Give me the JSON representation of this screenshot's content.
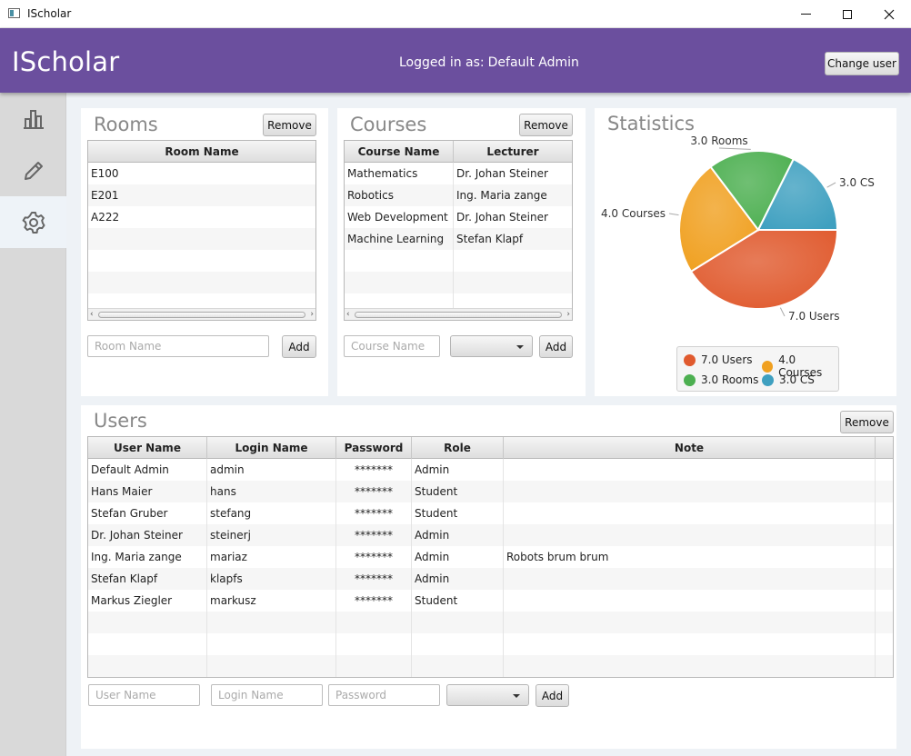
{
  "window": {
    "title": "IScholar"
  },
  "header": {
    "brand": "IScholar",
    "logged_label": "Logged in as:",
    "logged_user": "Default Admin",
    "change_user_label": "Change user"
  },
  "sidebar": {
    "items": [
      {
        "name": "statistics",
        "icon": "bar-chart-icon"
      },
      {
        "name": "edit",
        "icon": "pencil-icon"
      },
      {
        "name": "settings",
        "icon": "gear-icon",
        "active": true
      }
    ]
  },
  "rooms": {
    "title": "Rooms",
    "remove_label": "Remove",
    "columns": [
      "Room Name"
    ],
    "rows": [
      [
        "E100"
      ],
      [
        "E201"
      ],
      [
        "A222"
      ]
    ],
    "input_placeholder": "Room Name",
    "add_label": "Add"
  },
  "courses": {
    "title": "Courses",
    "remove_label": "Remove",
    "columns": [
      "Course Name",
      "Lecturer"
    ],
    "rows": [
      [
        "Mathematics",
        "Dr. Johan Steiner"
      ],
      [
        "Robotics",
        "Ing. Maria zange"
      ],
      [
        "Web Development",
        "Dr. Johan Steiner"
      ],
      [
        "Machine Learning",
        "Stefan Klapf"
      ]
    ],
    "input_placeholder": "Course Name",
    "add_label": "Add"
  },
  "statistics": {
    "title": "Statistics",
    "colors": {
      "users": "#e05a2e",
      "courses": "#f0a020",
      "rooms": "#4caf50",
      "cs": "#3fa0c0"
    }
  },
  "chart_data": {
    "type": "pie",
    "title": "Statistics",
    "slices": [
      {
        "label": "7.0 Users",
        "value": 7.0,
        "color": "#e05a2e"
      },
      {
        "label": "4.0 Courses",
        "value": 4.0,
        "color": "#f0a020"
      },
      {
        "label": "3.0 Rooms",
        "value": 3.0,
        "color": "#4caf50"
      },
      {
        "label": "3.0 CS",
        "value": 3.0,
        "color": "#3fa0c0"
      }
    ],
    "legend": [
      "7.0 Users",
      "4.0 Courses",
      "3.0 Rooms",
      "3.0 CS"
    ],
    "legend_position": "bottom"
  },
  "users": {
    "title": "Users",
    "remove_label": "Remove",
    "columns": [
      "User Name",
      "Login Name",
      "Password",
      "Role",
      "Note"
    ],
    "rows": [
      [
        "Default Admin",
        "admin",
        "*******",
        "Admin",
        ""
      ],
      [
        "Hans Maier",
        "hans",
        "*******",
        "Student",
        ""
      ],
      [
        "Stefan Gruber",
        "stefang",
        "*******",
        "Student",
        ""
      ],
      [
        "Dr. Johan Steiner",
        "steinerj",
        "*******",
        "Admin",
        ""
      ],
      [
        "Ing. Maria zange",
        "mariaz",
        "*******",
        "Admin",
        "Robots brum brum"
      ],
      [
        "Stefan Klapf",
        "klapfs",
        "*******",
        "Admin",
        ""
      ],
      [
        "Markus Ziegler",
        "markusz",
        "*******",
        "Student",
        ""
      ]
    ],
    "user_placeholder": "User Name",
    "login_placeholder": "Login Name",
    "password_placeholder": "Password",
    "add_label": "Add"
  }
}
